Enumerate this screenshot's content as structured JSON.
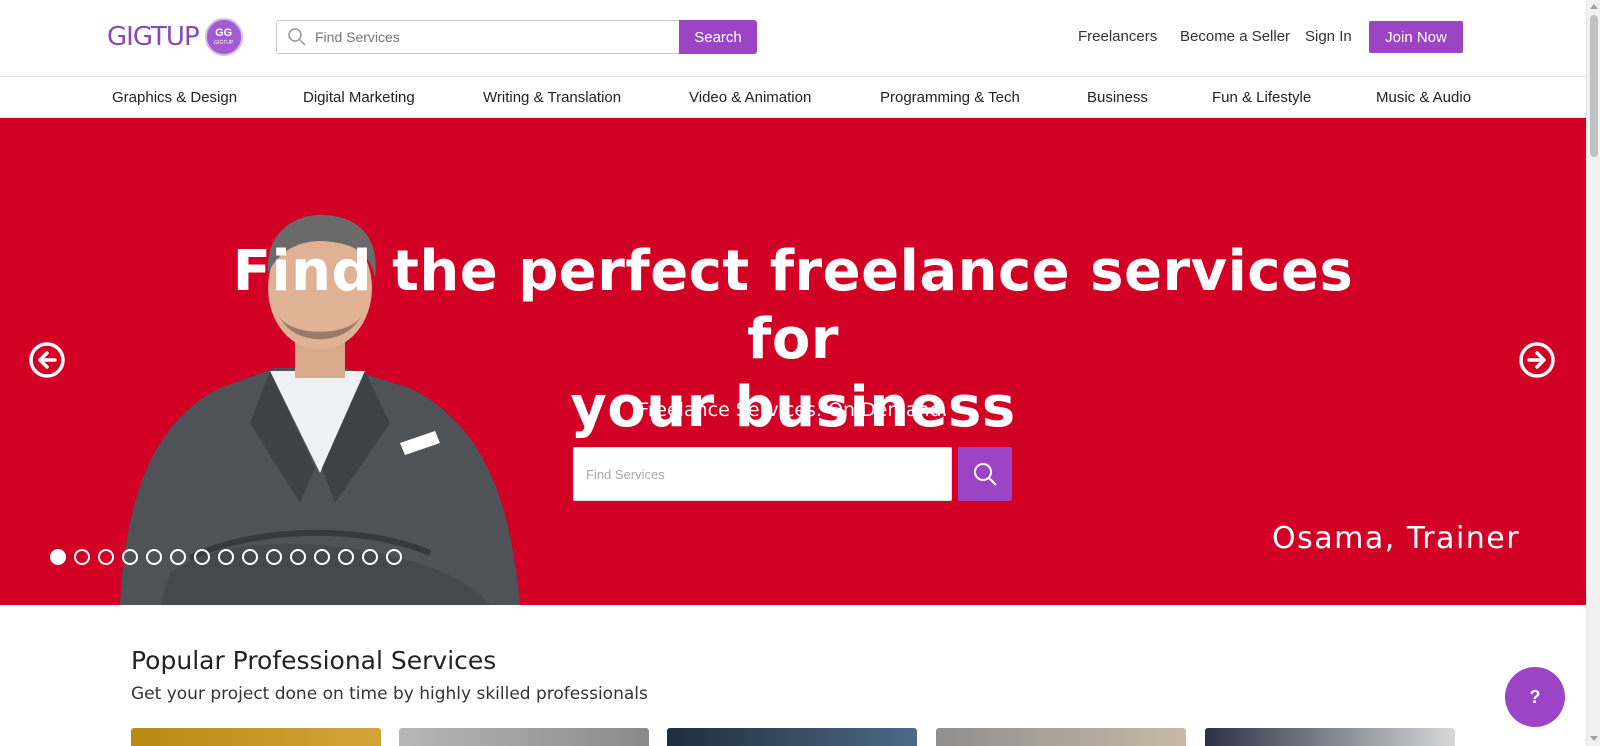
{
  "logo": {
    "text": "GIGTUP",
    "badge": "GG",
    "badge_small": "GIGTUP"
  },
  "header_search": {
    "placeholder": "Find Services",
    "button_label": "Search"
  },
  "nav": {
    "freelancers": "Freelancers",
    "become_seller": "Become a Seller",
    "sign_in": "Sign In",
    "join_now": "Join Now"
  },
  "categories": [
    "Graphics & Design",
    "Digital Marketing",
    "Writing & Translation",
    "Video & Animation",
    "Programming & Tech",
    "Business",
    "Fun & Lifestyle",
    "Music & Audio"
  ],
  "hero": {
    "title_line1": "Find the perfect freelance services for",
    "title_line2": "your business",
    "subtitle": "Freelance Services. On Demand.",
    "search_placeholder": "Find Services",
    "caption": "Osama, Trainer",
    "slide_count": 15,
    "active_slide": 1,
    "background_color": "#d20024"
  },
  "popular": {
    "title": "Popular Professional Services",
    "subtitle": "Get your project done on time by highly skilled professionals"
  },
  "help_button": {
    "label": "?"
  },
  "colors": {
    "accent": "#9b45c6",
    "hero_red": "#d20024"
  }
}
